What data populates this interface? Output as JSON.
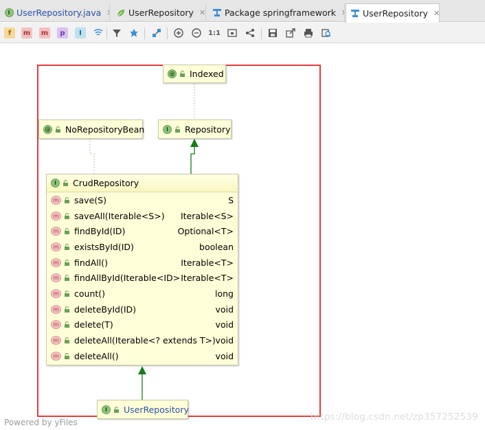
{
  "tabs": [
    {
      "label": "UserRepository.java",
      "icon": "interface-icon",
      "close": "✕"
    },
    {
      "label": "UserRepository",
      "icon": "leaf-icon",
      "close": "✕"
    },
    {
      "label": "Package springframework",
      "icon": "diagram-icon",
      "close": "✕"
    },
    {
      "label": "UserRepository",
      "icon": "diagram-icon",
      "close": "✕"
    }
  ],
  "toolbar": {
    "fields": "f",
    "methods": "m",
    "constructors": "m",
    "properties": "p",
    "inner": "I",
    "zoom_actual": "1:1"
  },
  "nodes": {
    "indexed": {
      "name": "Indexed",
      "kind": "@"
    },
    "no_repository_bean": {
      "name": "NoRepositoryBean",
      "kind": "@"
    },
    "repository": {
      "name": "Repository",
      "kind": "I"
    },
    "user_repository": {
      "name": "UserRepository",
      "kind": "I"
    }
  },
  "crud": {
    "name": "CrudRepository",
    "kind": "I",
    "method_badge": "m",
    "methods": [
      {
        "name": "save(S)",
        "type": "S"
      },
      {
        "name": "saveAll(Iterable<S>)",
        "type": "Iterable<S>"
      },
      {
        "name": "findById(ID)",
        "type": "Optional<T>"
      },
      {
        "name": "existsById(ID)",
        "type": "boolean"
      },
      {
        "name": "findAll()",
        "type": "Iterable<T>"
      },
      {
        "name": "findAllById(Iterable<ID>)",
        "type": "Iterable<T>"
      },
      {
        "name": "count()",
        "type": "long"
      },
      {
        "name": "deleteById(ID)",
        "type": "void"
      },
      {
        "name": "delete(T)",
        "type": "void"
      },
      {
        "name": "deleteAll(Iterable<? extends T>)",
        "type": "void"
      },
      {
        "name": "deleteAll()",
        "type": "void"
      }
    ]
  },
  "footer": {
    "powered_by": "Powered by yFiles",
    "watermark": "https://blog.csdn.net/zp357252539"
  },
  "colors": {
    "highlight_frame": "#e53b3b",
    "node_fill": "#fefed8",
    "inheritance_arrow": "#1a7a1a"
  }
}
